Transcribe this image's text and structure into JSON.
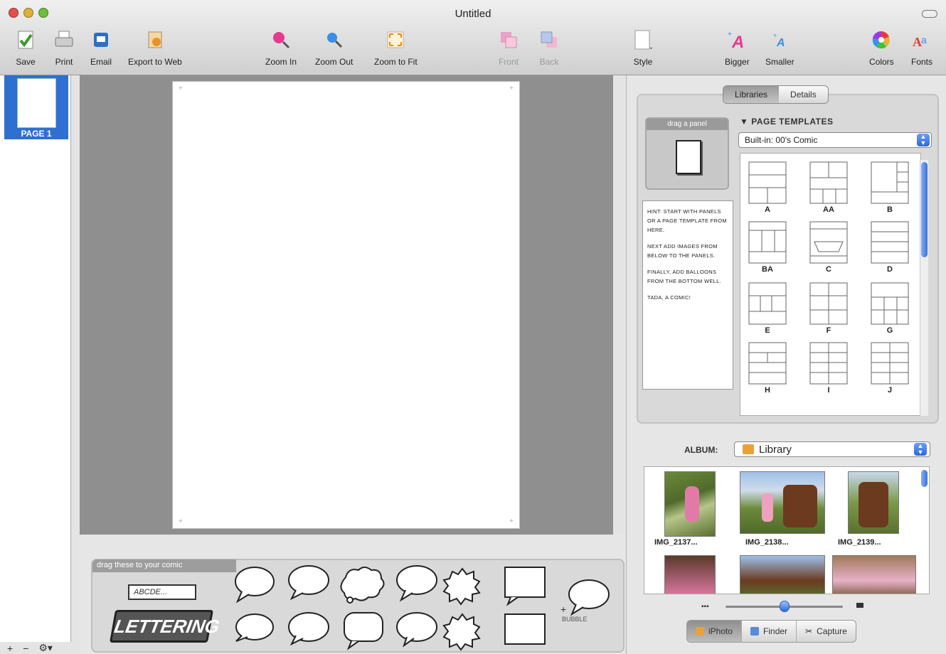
{
  "window": {
    "title": "Untitled"
  },
  "toolbar": {
    "save": "Save",
    "print": "Print",
    "email": "Email",
    "export": "Export to Web",
    "zoom_in": "Zoom In",
    "zoom_out": "Zoom Out",
    "zoom_fit": "Zoom to Fit",
    "front": "Front",
    "back": "Back",
    "style": "Style",
    "bigger": "Bigger",
    "smaller": "Smaller",
    "colors": "Colors",
    "fonts": "Fonts"
  },
  "pages": {
    "items": [
      {
        "label": "PAGE 1"
      }
    ],
    "add": "+",
    "remove": "−",
    "action": "⚙▾"
  },
  "balloons": {
    "header": "drag these to your comic",
    "text_field": "ABCDE...",
    "lettering": "LETTERING",
    "balloon_label": "BUBBLE"
  },
  "library": {
    "tabs": [
      "Libraries",
      "Details"
    ],
    "drag_panel": "drag a panel",
    "hint": [
      "HINT: START WITH PANELS OR A PAGE TEMPLATE FROM HERE.",
      "NEXT ADD IMAGES FROM BELOW TO THE PANELS.",
      "FINALLY, ADD BALLOONS FROM THE BOTTOM WELL.",
      "TADA, A COMIC!"
    ],
    "templates_title": "PAGE TEMPLATES",
    "template_select": "Built-in: 00's Comic",
    "templates": [
      "A",
      "AA",
      "B",
      "BA",
      "C",
      "D",
      "E",
      "F",
      "G",
      "H",
      "I",
      "J"
    ]
  },
  "album": {
    "label": "ALBUM:",
    "select": "Library",
    "photos": [
      "IMG_2137...",
      "IMG_2138...",
      "IMG_2139..."
    ],
    "buttons": [
      "iPhoto",
      "Finder",
      "Capture"
    ]
  }
}
